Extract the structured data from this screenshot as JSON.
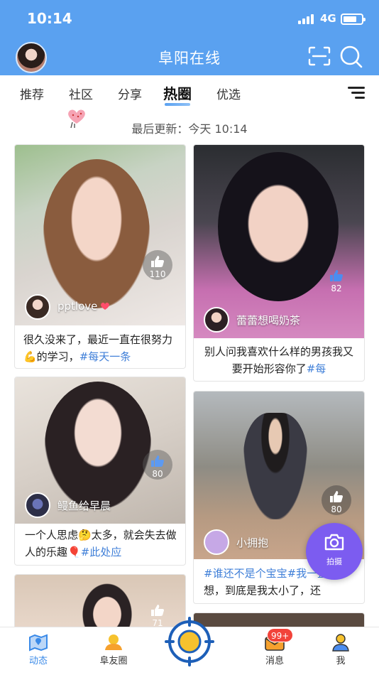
{
  "status_bar": {
    "time": "10:14",
    "network": "4G"
  },
  "header": {
    "title": "阜阳在线",
    "avatar_icon": "user-avatar",
    "scan_icon": "scan-icon",
    "search_icon": "search-icon"
  },
  "tabs": [
    {
      "label": "推荐",
      "active": false
    },
    {
      "label": "社区",
      "active": false
    },
    {
      "label": "分享",
      "active": false
    },
    {
      "label": "热圈",
      "active": true
    },
    {
      "label": "优选",
      "active": false
    }
  ],
  "update": {
    "text": "最后更新：今天 10:14"
  },
  "cards": [
    {
      "user": "pptlove",
      "likes": "110",
      "caption_text": "很久没来了，最近一直在很努力💪的学习，",
      "caption_tag": "#每天一条"
    },
    {
      "user": "蕾蕾想喝奶茶",
      "likes": "82",
      "caption_text": "别人问我喜欢什么样的男孩我又要开始形容你了",
      "caption_tag": "#每"
    },
    {
      "user": "鳗鱼给早晨",
      "likes": "80",
      "caption_text": "一个人思虑🤔太多，就会失去做人的乐趣🎈",
      "caption_tag": "#此处应"
    },
    {
      "user": "小拥抱",
      "likes": "80",
      "caption_tag": "#谁还不是个宝宝",
      "caption_tag2": "#我一直",
      "caption_text": "在想，到底是我太小了，还"
    },
    {
      "likes": "71"
    }
  ],
  "fab": {
    "label": "拍摄",
    "icon": "camera-icon"
  },
  "bottom_nav": [
    {
      "label": "动态",
      "active": true,
      "icon": "map-icon"
    },
    {
      "label": "阜友圈",
      "active": false,
      "icon": "friends-icon"
    },
    {
      "label": "",
      "active": false,
      "icon": "center-target-icon"
    },
    {
      "label": "消息",
      "active": false,
      "icon": "message-icon",
      "badge": "99+"
    },
    {
      "label": "我",
      "active": false,
      "icon": "profile-icon"
    }
  ],
  "colors": {
    "primary": "#5aa1f0",
    "tag": "#3f7fd8",
    "fab": "#7c5cf0",
    "badge": "#f2433a"
  }
}
